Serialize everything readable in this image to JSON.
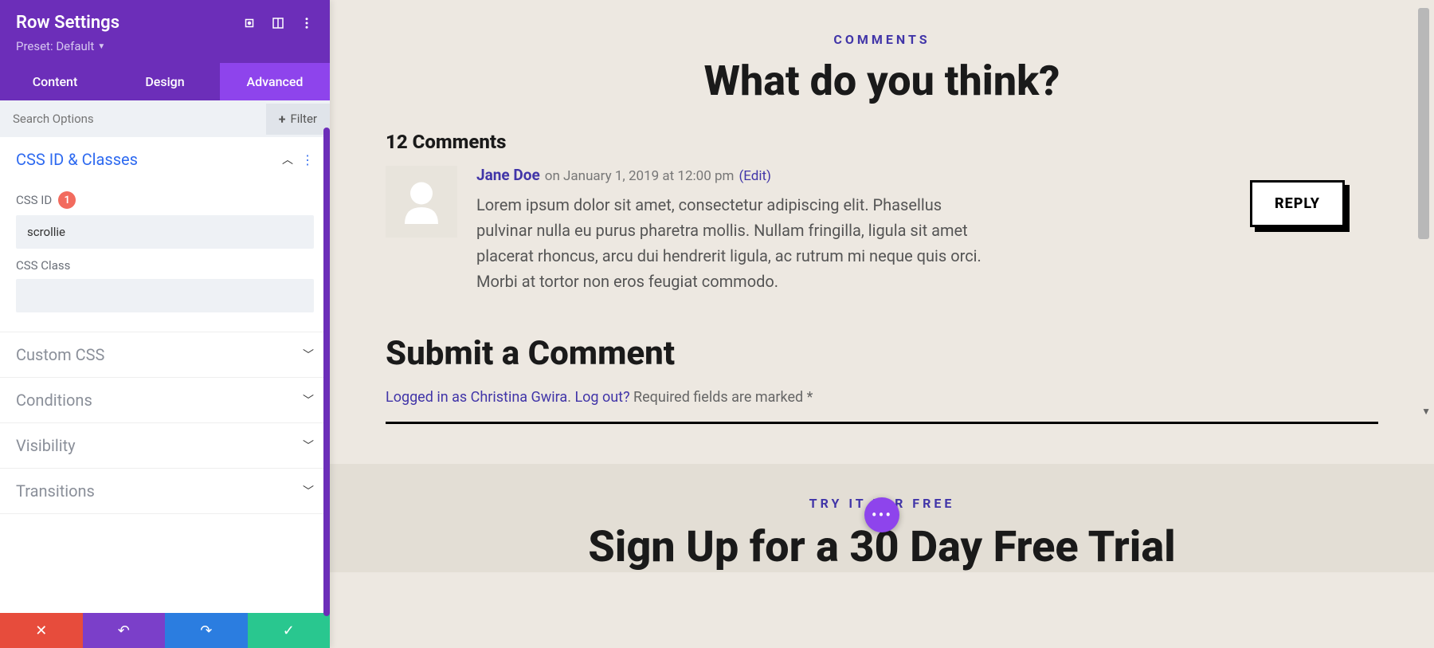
{
  "sidebar": {
    "title": "Row Settings",
    "preset_label": "Preset: Default",
    "tabs": [
      "Content",
      "Design",
      "Advanced"
    ],
    "active_tab": 2,
    "search_placeholder": "Search Options",
    "filter_label": "Filter",
    "sections": {
      "css_id_classes": {
        "title": "CSS ID & Classes",
        "css_id_label": "CSS ID",
        "css_id_badge": "1",
        "css_id_value": "scrollie",
        "css_class_label": "CSS Class",
        "css_class_value": ""
      },
      "custom_css": "Custom CSS",
      "conditions": "Conditions",
      "visibility": "Visibility",
      "transitions": "Transitions"
    }
  },
  "preview": {
    "comments_eyebrow": "COMMENTS",
    "comments_heading": "What do you think?",
    "comments_count": "12 Comments",
    "comment": {
      "author": "Jane Doe",
      "meta": "on January 1, 2019 at 12:00 pm",
      "edit": "(Edit)",
      "text": "Lorem ipsum dolor sit amet, consectetur adipiscing elit. Phasellus pulvinar nulla eu purus pharetra mollis. Nullam fringilla, ligula sit amet placerat rhoncus, arcu dui hendrerit ligula, ac rutrum mi neque quis orci. Morbi at tortor non eros feugiat commodo."
    },
    "reply_label": "REPLY",
    "submit_heading": "Submit a Comment",
    "submit_logged_in": "Logged in as Christina Gwira",
    "submit_logout": "Log out?",
    "submit_required": " Required fields are marked *",
    "trial_eyebrow": "TRY IT FOR FREE",
    "trial_heading": "Sign Up for a 30 Day Free Trial"
  }
}
